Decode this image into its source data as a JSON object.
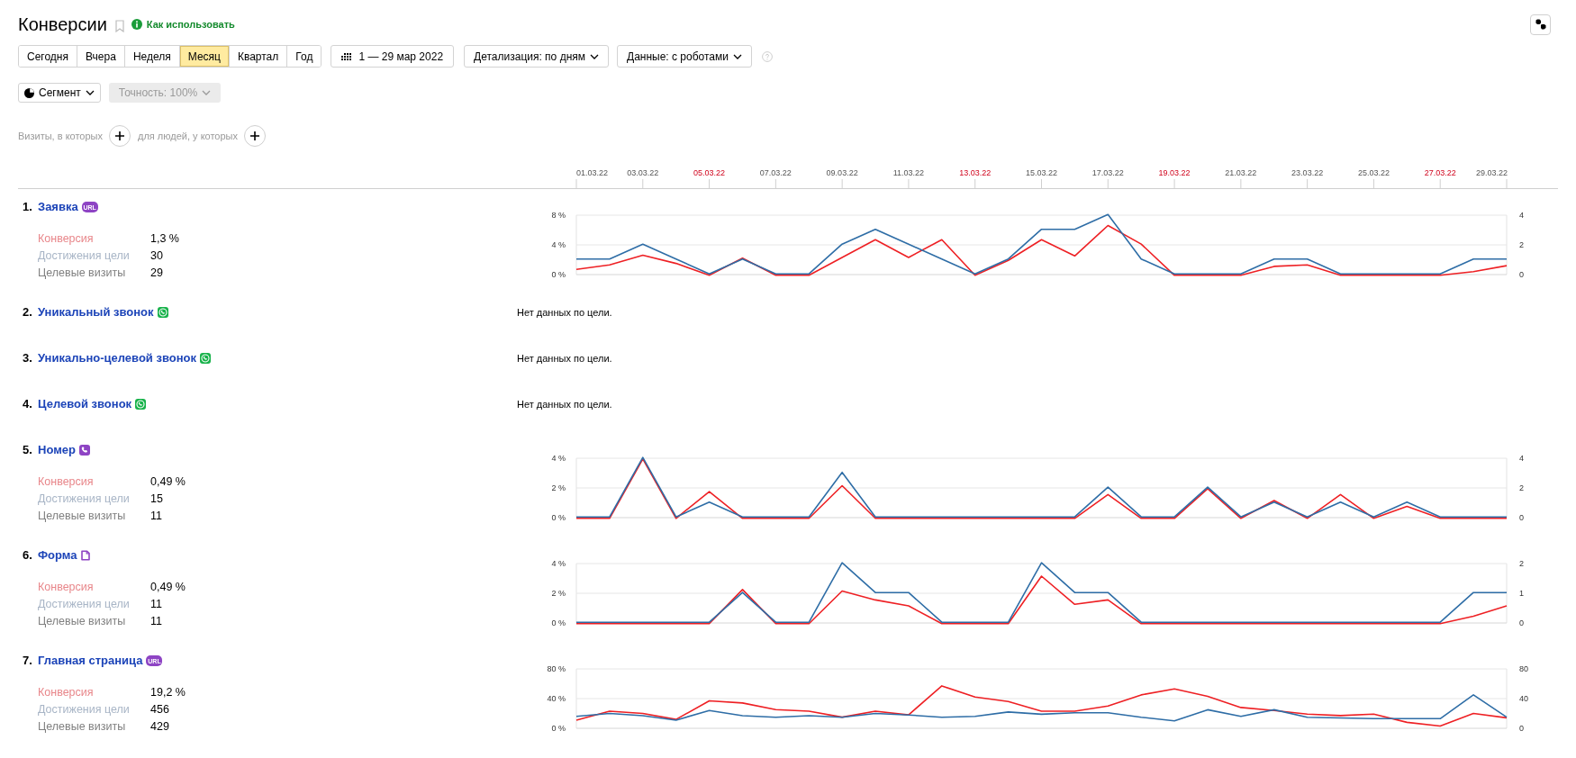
{
  "header": {
    "title": "Конверсии",
    "help_link": "Как использовать"
  },
  "periods": [
    {
      "label": "Сегодня",
      "selected": false
    },
    {
      "label": "Вчера",
      "selected": false
    },
    {
      "label": "Неделя",
      "selected": false
    },
    {
      "label": "Месяц",
      "selected": true
    },
    {
      "label": "Квартал",
      "selected": false
    },
    {
      "label": "Год",
      "selected": false
    }
  ],
  "date_range": "1 — 29 мар 2022",
  "dropdowns": [
    "Детализация: по дням",
    "Данные: с роботами"
  ],
  "segment": {
    "label": "Сегмент"
  },
  "accuracy": {
    "label": "Точность: 100%",
    "disabled": true
  },
  "filters": [
    "Визиты, в которых",
    "для людей, у которых"
  ],
  "date_axis": [
    {
      "label": "01.03.22",
      "weekend": false
    },
    {
      "label": "03.03.22",
      "weekend": false
    },
    {
      "label": "05.03.22",
      "weekend": true
    },
    {
      "label": "07.03.22",
      "weekend": false
    },
    {
      "label": "09.03.22",
      "weekend": false
    },
    {
      "label": "11.03.22",
      "weekend": false
    },
    {
      "label": "13.03.22",
      "weekend": true
    },
    {
      "label": "15.03.22",
      "weekend": false
    },
    {
      "label": "17.03.22",
      "weekend": false
    },
    {
      "label": "19.03.22",
      "weekend": true
    },
    {
      "label": "21.03.22",
      "weekend": false
    },
    {
      "label": "23.03.22",
      "weekend": false
    },
    {
      "label": "25.03.22",
      "weekend": false
    },
    {
      "label": "27.03.22",
      "weekend": true
    },
    {
      "label": "29.03.22",
      "weekend": false
    }
  ],
  "goals": [
    {
      "number": "1.",
      "title": "Заявка",
      "kind": "url",
      "badge": "URL",
      "stats": [
        {
          "label": "Конверсия",
          "value": "1,3 %",
          "color": "#e8868a"
        },
        {
          "label": "Достижения цели",
          "value": "30",
          "color": "#a8b5c6"
        },
        {
          "label": "Целевые визиты",
          "value": "29",
          "color": "#808080"
        }
      ],
      "chart_data": {
        "type": "line",
        "ylim": [
          0,
          8
        ],
        "yticks": [
          {
            "value": 0,
            "label": "0 %"
          },
          {
            "value": 4,
            "label": "4 %"
          },
          {
            "value": 8,
            "label": "8 %"
          }
        ],
        "y2lim": [
          0,
          4
        ],
        "y2ticks": [
          0,
          2,
          4
        ],
        "series": [
          {
            "color": "#ee2024",
            "values": [
              0.8,
              1.4,
              2.7,
              1.6,
              0,
              2.3,
              0,
              0,
              2.4,
              4.8,
              2.4,
              4.8,
              0,
              2,
              4.8,
              2.6,
              6.7,
              4.2,
              0,
              0,
              0,
              1.2,
              1.4,
              0,
              0,
              0,
              0,
              0.5,
              1.3
            ]
          },
          {
            "axis": "y2",
            "color": "#2e6da6",
            "values": [
              1,
              1,
              2,
              1,
              0,
              1,
              0,
              0,
              2,
              3,
              2,
              1,
              0,
              1,
              3,
              3,
              4,
              1,
              0,
              0,
              0,
              1,
              1,
              0,
              0,
              0,
              0,
              1,
              1
            ]
          }
        ]
      }
    },
    {
      "number": "2.",
      "title": "Уникальный звонок",
      "kind": "call",
      "no_data": "Нет данных по цели."
    },
    {
      "number": "3.",
      "title": "Уникально-целевой звонок",
      "kind": "call",
      "no_data": "Нет данных по цели."
    },
    {
      "number": "4.",
      "title": "Целевой звонок",
      "kind": "call",
      "no_data": "Нет данных по цели."
    },
    {
      "number": "5.",
      "title": "Номер",
      "kind": "phone",
      "stats": [
        {
          "label": "Конверсия",
          "value": "0,49 %",
          "color": "#e8868a"
        },
        {
          "label": "Достижения цели",
          "value": "15",
          "color": "#a8b5c6"
        },
        {
          "label": "Целевые визиты",
          "value": "11",
          "color": "#808080"
        }
      ],
      "chart_data": {
        "type": "line",
        "ylim": [
          0,
          4
        ],
        "yticks": [
          {
            "value": 0,
            "label": "0 %"
          },
          {
            "value": 2,
            "label": "2 %"
          },
          {
            "value": 4,
            "label": "4 %"
          }
        ],
        "y2lim": [
          0,
          4
        ],
        "y2ticks": [
          0,
          2,
          4
        ],
        "series": [
          {
            "color": "#ee2024",
            "values": [
              0,
              0,
              4,
              0,
              1.8,
              0,
              0,
              0,
              2.2,
              0,
              0,
              0,
              0,
              0,
              0,
              0,
              1.6,
              0,
              0,
              2,
              0,
              1.2,
              0,
              1.6,
              0,
              0.8,
              0,
              0,
              0
            ]
          },
          {
            "axis": "y2",
            "color": "#2e6da6",
            "values": [
              0,
              0,
              4,
              0,
              1,
              0,
              0,
              0,
              3,
              0,
              0,
              0,
              0,
              0,
              0,
              0,
              2,
              0,
              0,
              2,
              0,
              1,
              0,
              1,
              0,
              1,
              0,
              0,
              0
            ]
          }
        ]
      }
    },
    {
      "number": "6.",
      "title": "Форма",
      "kind": "form",
      "stats": [
        {
          "label": "Конверсия",
          "value": "0,49 %",
          "color": "#e8868a"
        },
        {
          "label": "Достижения цели",
          "value": "11",
          "color": "#a8b5c6"
        },
        {
          "label": "Целевые визиты",
          "value": "11",
          "color": "#808080"
        }
      ],
      "chart_data": {
        "type": "line",
        "ylim": [
          0,
          4
        ],
        "yticks": [
          {
            "value": 0,
            "label": "0 %"
          },
          {
            "value": 2,
            "label": "2 %"
          },
          {
            "value": 4,
            "label": "4 %"
          }
        ],
        "y2lim": [
          0,
          2
        ],
        "y2ticks": [
          0,
          1,
          2
        ],
        "series": [
          {
            "color": "#ee2024",
            "values": [
              0,
              0,
              0,
              0,
              0,
              2.3,
              0,
              0,
              2.2,
              1.6,
              1.2,
              0,
              0,
              0,
              3.2,
              1.3,
              1.6,
              0,
              0,
              0,
              0,
              0,
              0,
              0,
              0,
              0,
              0,
              0.5,
              1.2
            ]
          },
          {
            "axis": "y2",
            "color": "#2e6da6",
            "values": [
              0,
              0,
              0,
              0,
              0,
              1,
              0,
              0,
              2,
              1,
              1,
              0,
              0,
              0,
              2,
              1,
              1,
              0,
              0,
              0,
              0,
              0,
              0,
              0,
              0,
              0,
              0,
              1,
              1
            ]
          }
        ]
      }
    },
    {
      "number": "7.",
      "title": "Главная страница",
      "kind": "url",
      "badge": "URL",
      "stats": [
        {
          "label": "Конверсия",
          "value": "19,2 %",
          "color": "#e8868a"
        },
        {
          "label": "Достижения цели",
          "value": "456",
          "color": "#a8b5c6"
        },
        {
          "label": "Целевые визиты",
          "value": "429",
          "color": "#808080"
        }
      ],
      "chart_data": {
        "type": "line",
        "ylim": [
          0,
          80
        ],
        "yticks": [
          {
            "value": 0,
            "label": "0 %"
          },
          {
            "value": 40,
            "label": "40 %"
          },
          {
            "value": 80,
            "label": "80 %"
          }
        ],
        "y2lim": [
          0,
          80
        ],
        "y2ticks": [
          0,
          40,
          80
        ],
        "series": [
          {
            "color": "#ee2024",
            "values": [
              12,
              24,
              21,
              13,
              38,
              35,
              26,
              24,
              16,
              24,
              19,
              58,
              43,
              37,
              24,
              24,
              31,
              46,
              54,
              44,
              29,
              25,
              20,
              18,
              20,
              9,
              4,
              21,
              15
            ]
          },
          {
            "axis": "y2",
            "color": "#2e6da6",
            "values": [
              15,
              19,
              16,
              10,
              23,
              16,
              14,
              16,
              14,
              19,
              17,
              14,
              15,
              21,
              18,
              20,
              20,
              14,
              9,
              24,
              15,
              24,
              14,
              13,
              12,
              12,
              12,
              44,
              14
            ]
          }
        ]
      }
    }
  ]
}
